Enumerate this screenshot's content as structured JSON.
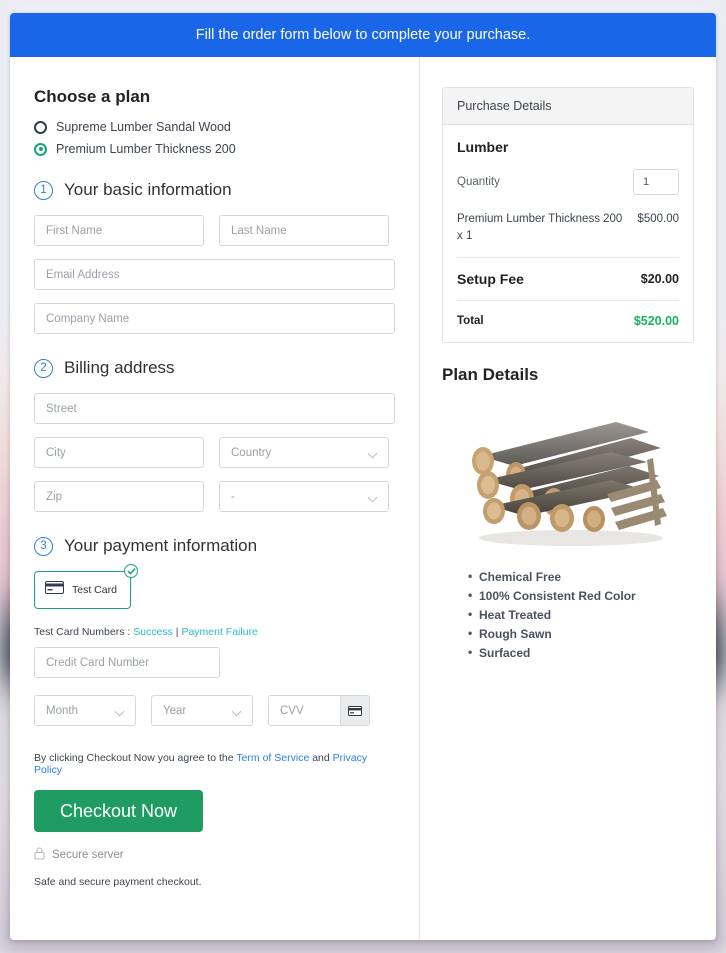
{
  "banner": {
    "text": "Fill the order form below to complete your purchase."
  },
  "plan": {
    "heading": "Choose a plan",
    "options": [
      {
        "label": "Supreme Lumber Sandal Wood",
        "selected": false
      },
      {
        "label": "Premium Lumber Thickness 200",
        "selected": true
      }
    ]
  },
  "steps": {
    "basic": {
      "number": "1",
      "title": "Your basic information"
    },
    "billing": {
      "number": "2",
      "title": "Billing address"
    },
    "payment": {
      "number": "3",
      "title": "Your payment information"
    }
  },
  "fields": {
    "first_name": "First Name",
    "last_name": "Last Name",
    "email": "Email Address",
    "company": "Company Name",
    "street": "Street",
    "city": "City",
    "country": "Country",
    "zip": "Zip",
    "state": "-",
    "credit_card": "Credit Card Number",
    "month": "Month",
    "year": "Year",
    "cvv": "CVV"
  },
  "payment": {
    "tile_label": "Test Card",
    "test_numbers_prefix": "Test Card Numbers : ",
    "success_link": "Success",
    "separator": " | ",
    "failure_link": "Payment Failure"
  },
  "terms": {
    "prefix": "By clicking Checkout Now you agree to the ",
    "tos": "Term of Service",
    "and": " and ",
    "privacy": "Privacy Policy"
  },
  "checkout": {
    "button": "Checkout Now",
    "secure_server": "Secure server",
    "safe_note": "Safe and secure payment checkout."
  },
  "purchase": {
    "header": "Purchase Details",
    "product_title": "Lumber",
    "quantity_label": "Quantity",
    "quantity_value": "1",
    "line_item": "Premium Lumber Thickness 200 x 1",
    "line_amount": "$500.00",
    "setup_fee_label": "Setup Fee",
    "setup_fee_amount": "$20.00",
    "total_label": "Total",
    "total_amount": "$520.00"
  },
  "plan_details": {
    "title": "Plan Details",
    "image_alt": "stack-of-logs",
    "features": [
      "Chemical Free",
      "100% Consistent Red Color",
      "Heat Treated",
      "Rough Sawn",
      "Surfaced"
    ]
  },
  "colors": {
    "banner_blue": "#1a66e8",
    "accent_green": "#17a673",
    "checkout_green": "#1f9c62",
    "total_green": "#19b35c",
    "step_blue": "#2a7fe0",
    "link_teal": "#2bbbc4",
    "link_blue": "#2a7fe0"
  }
}
